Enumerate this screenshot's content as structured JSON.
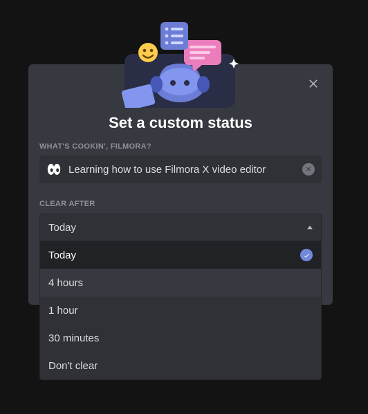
{
  "modal": {
    "title": "Set a custom status",
    "question_label": "WHAT'S COOKIN', FILMORA?",
    "status_emoji": "eyes",
    "status_text": "Learning how to use Filmora X video editor",
    "clear_label": "CLEAR AFTER",
    "clear_selected": "Today",
    "clear_options": [
      "Today",
      "4 hours",
      "1 hour",
      "30 minutes",
      "Don't clear"
    ],
    "hover_index": 1
  }
}
